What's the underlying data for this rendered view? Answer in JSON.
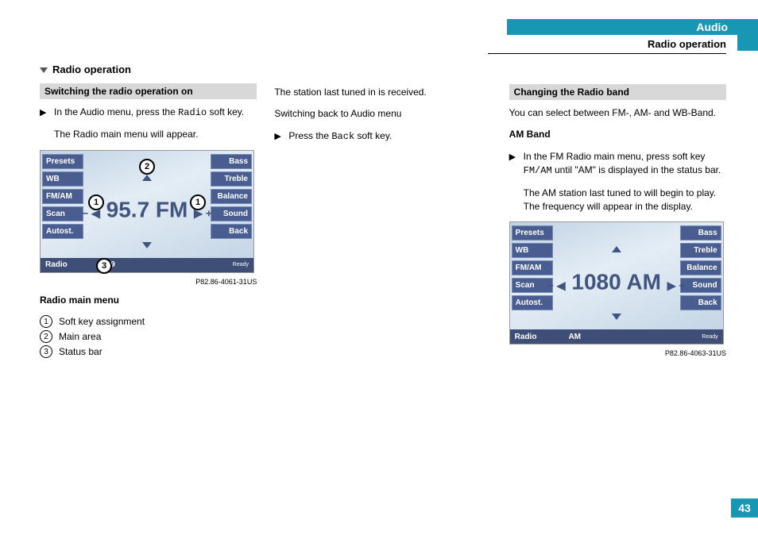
{
  "header": {
    "category": "Audio",
    "subtitle": "Radio operation"
  },
  "page_number": "43",
  "col1": {
    "section_title": "Radio operation",
    "box1_title": "Switching the radio operation on",
    "b1_pre": "In the Audio menu, press the ",
    "b1_code": "Radio",
    "b1_post": " soft key.",
    "p1": "The Radio main menu will appear.",
    "fig_id": "P82.86-4061-31US",
    "caption": "Radio main menu",
    "leg1": "Soft key assignment",
    "leg2": "Main area",
    "leg3": "Status bar"
  },
  "col2": {
    "p1": "The station last tuned in is received.",
    "p2": "Switching back to Audio menu",
    "b1_pre": "Press the ",
    "b1_code": "Back",
    "b1_post": " soft key."
  },
  "col3": {
    "box_title": "Changing the Radio band",
    "p1": "You can select between FM-, AM- and WB-Band.",
    "h": "AM Band",
    "b1_pre": "In the FM Radio main menu, press soft key ",
    "b1_code": "FM/AM",
    "b1_post": " until \"AM\" is displayed in the status bar.",
    "p2": "The AM station last tuned to will begin to play. The frequency will appear in the display.",
    "fig_id": "P82.86-4063-31US"
  },
  "radio1": {
    "left": [
      "Presets",
      "WB",
      "FM/AM",
      "Scan",
      "Autost."
    ],
    "right": [
      "Bass",
      "Treble",
      "Balance",
      "Sound",
      "Back"
    ],
    "freq": "95.7 FM",
    "status_left": "Radio",
    "status_mid": "FM9",
    "ready": "Ready"
  },
  "radio2": {
    "left": [
      "Presets",
      "WB",
      "FM/AM",
      "Scan",
      "Autost."
    ],
    "right": [
      "Bass",
      "Treble",
      "Balance",
      "Sound",
      "Back"
    ],
    "freq": "1080 AM",
    "status_left": "Radio",
    "status_mid": "AM",
    "ready": "Ready"
  },
  "labels": {
    "c1": "1",
    "c2": "2",
    "c3": "3"
  }
}
